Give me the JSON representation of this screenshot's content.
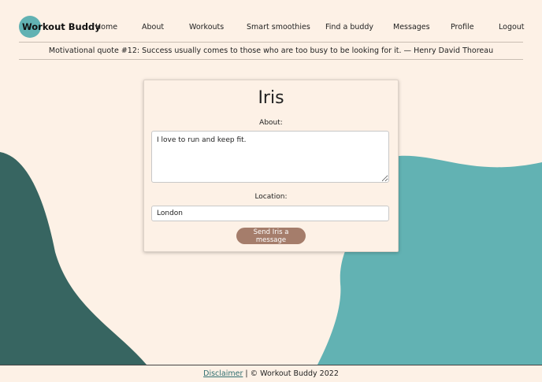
{
  "brand": {
    "name": "Workout Buddy"
  },
  "nav": {
    "items": [
      {
        "label": "Home"
      },
      {
        "label": "About"
      },
      {
        "label": "Workouts"
      },
      {
        "label": "Smart smoothies"
      },
      {
        "label": "Find a buddy"
      },
      {
        "label": "Messages"
      },
      {
        "label": "Profile"
      },
      {
        "label": "Logout"
      }
    ]
  },
  "quote": {
    "text": "Motivational quote #12: Success usually comes to those who are too busy to be looking for it. — Henry David Thoreau"
  },
  "profile": {
    "name": "Iris",
    "about_label": "About:",
    "about_value": "I love to run and keep fit.",
    "location_label": "Location:",
    "location_value": "London",
    "send_button_label": "Send Iris a message"
  },
  "footer": {
    "disclaimer_link": "Disclaimer",
    "separator": "|",
    "copyright": "© Workout Buddy 2022"
  },
  "colors": {
    "background": "#fdf1e6",
    "teal": "#62b2b3",
    "dark_teal": "#376561",
    "button": "#a57d6b"
  }
}
